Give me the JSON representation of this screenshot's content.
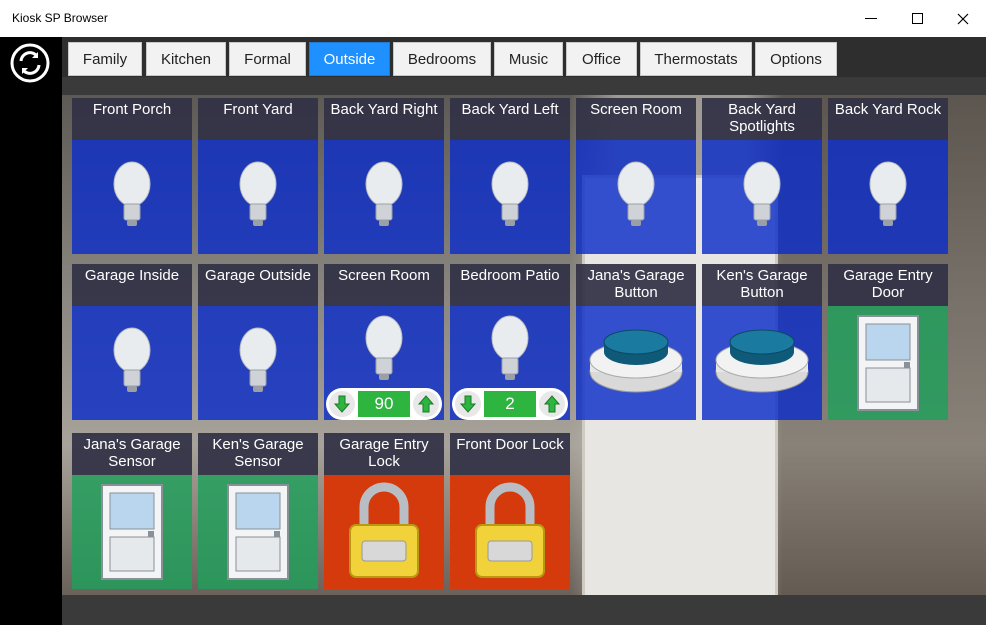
{
  "window": {
    "title": "Kiosk SP Browser"
  },
  "tabs": [
    {
      "label": "Family"
    },
    {
      "label": "Kitchen"
    },
    {
      "label": "Formal"
    },
    {
      "label": "Outside",
      "active": true
    },
    {
      "label": "Bedrooms"
    },
    {
      "label": "Music"
    },
    {
      "label": "Office"
    },
    {
      "label": "Thermostats"
    },
    {
      "label": "Options"
    }
  ],
  "tiles": {
    "front_porch": {
      "label": "Front Porch",
      "icon": "light-bulb-icon"
    },
    "front_yard": {
      "label": "Front Yard",
      "icon": "light-bulb-icon"
    },
    "back_yard_right": {
      "label": "Back Yard Right",
      "icon": "light-bulb-icon"
    },
    "back_yard_left": {
      "label": "Back Yard Left",
      "icon": "light-bulb-icon"
    },
    "screen_room_1": {
      "label": "Screen Room",
      "icon": "light-bulb-icon"
    },
    "back_yard_spotlights": {
      "label": "Back Yard Spotlights",
      "icon": "light-bulb-icon"
    },
    "back_yard_rock": {
      "label": "Back Yard Rock",
      "icon": "light-bulb-icon"
    },
    "garage_inside": {
      "label": "Garage Inside",
      "icon": "light-bulb-icon"
    },
    "garage_outside": {
      "label": "Garage Outside",
      "icon": "light-bulb-icon"
    },
    "screen_room_2": {
      "label": "Screen Room",
      "icon": "light-bulb-icon",
      "level": "90"
    },
    "bedroom_patio": {
      "label": "Bedroom Patio",
      "icon": "light-bulb-icon",
      "level": "2"
    },
    "janas_garage_button": {
      "label": "Jana's Garage Button",
      "icon": "push-button-icon"
    },
    "kens_garage_button": {
      "label": "Ken's Garage Button",
      "icon": "push-button-icon"
    },
    "garage_entry_door": {
      "label": "Garage Entry Door",
      "icon": "door-icon"
    },
    "janas_garage_sensor": {
      "label": "Jana's Garage Sensor",
      "icon": "door-icon"
    },
    "kens_garage_sensor": {
      "label": "Ken's Garage Sensor",
      "icon": "door-icon"
    },
    "garage_entry_lock": {
      "label": "Garage Entry Lock",
      "icon": "padlock-icon"
    },
    "front_door_lock": {
      "label": "Front Door Lock",
      "icon": "padlock-icon"
    }
  },
  "colors": {
    "light_tile": "#0c2dc8",
    "sensor_tile": "#1ea05a",
    "lock_tile": "#d43a0c",
    "active_tab": "#1e90ff",
    "level_green": "#2db53f"
  }
}
